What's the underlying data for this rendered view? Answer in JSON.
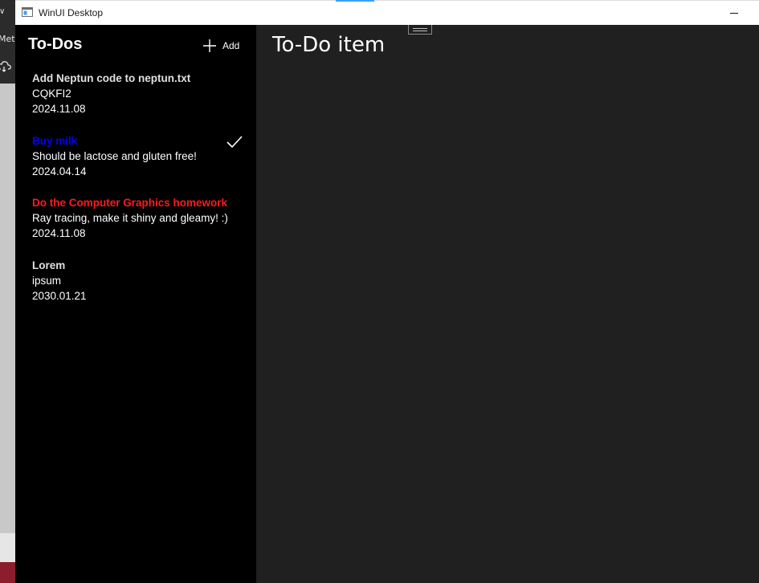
{
  "background_app": {
    "partial_text": "Mets",
    "colors": {
      "top": "#2b2b2b",
      "body": "#c8c8c8",
      "bottom_accent": "#8b1d2c"
    }
  },
  "window": {
    "title": "WinUI Desktop"
  },
  "todos_pane": {
    "header": "To-Dos",
    "add_label": "Add",
    "items": [
      {
        "title": "Add Neptun code to neptun.txt",
        "description": "CQKFI2",
        "date": "2024.11.08",
        "title_color": "#e0e0e0",
        "done": false
      },
      {
        "title": "Buy milk",
        "description": "Should be lactose and gluten free!",
        "date": "2024.04.14",
        "title_color": "#0000ff",
        "done": true
      },
      {
        "title": "Do the Computer Graphics homework",
        "description": "Ray tracing, make it shiny and gleamy! :)",
        "date": "2024.11.08",
        "title_color": "#ff1a1a",
        "done": false
      },
      {
        "title": "Lorem",
        "description": "ipsum",
        "date": "2030.01.21",
        "title_color": "#e0e0e0",
        "done": false
      }
    ]
  },
  "detail_pane": {
    "title": "To-Do item"
  }
}
